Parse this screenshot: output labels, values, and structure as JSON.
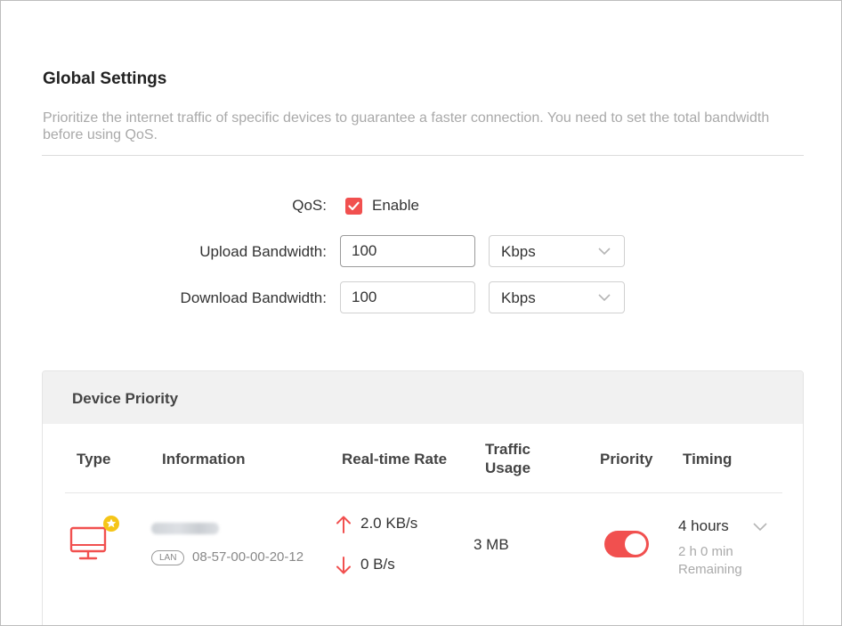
{
  "global_settings": {
    "title": "Global Settings",
    "description": "Prioritize the internet traffic of specific devices to guarantee a faster connection. You need to set the total bandwidth before using QoS."
  },
  "qos": {
    "label": "QoS:",
    "enable_label": "Enable",
    "enabled": true
  },
  "upload": {
    "label": "Upload Bandwidth:",
    "value": "100",
    "unit": "Kbps"
  },
  "download": {
    "label": "Download Bandwidth:",
    "value": "100",
    "unit": "Kbps"
  },
  "device_priority": {
    "title": "Device Priority",
    "columns": {
      "type": "Type",
      "information": "Information",
      "realtime_rate": "Real-time Rate",
      "traffic_usage_line1": "Traffic",
      "traffic_usage_line2": "Usage",
      "priority": "Priority",
      "timing": "Timing"
    },
    "devices": [
      {
        "icon": "desktop-icon",
        "connection": "LAN",
        "mac": "08-57-00-00-20-12",
        "upload_rate": "2.0 KB/s",
        "download_rate": "0 B/s",
        "traffic_usage": "3 MB",
        "priority_enabled": true,
        "timing": "4 hours",
        "remaining_line1": "2 h 0 min",
        "remaining_line2": "Remaining"
      }
    ]
  },
  "colors": {
    "accent": "#f1504f",
    "text_muted": "#a9a9a9",
    "panel_header_bg": "#f1f1f1",
    "star_badge": "#f5c518"
  }
}
